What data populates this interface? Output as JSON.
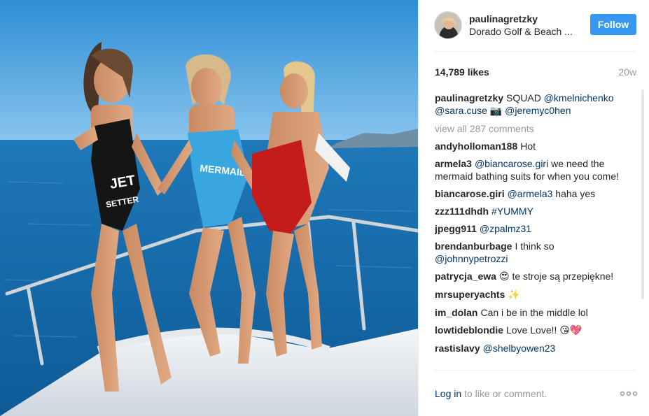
{
  "post": {
    "username": "paulinagretzky",
    "location": "Dorado Golf & Beach ...",
    "follow_label": "Follow",
    "likes": "14,789 likes",
    "age": "20w"
  },
  "caption": {
    "user": "paulinagretzky",
    "text": "SQUAD",
    "mention1": "@kmelnichenko",
    "mention2": "@sara.cuse",
    "camera_emoji": "📷",
    "mention3": "@jeremyc0hen"
  },
  "view_all": "view all 287 comments",
  "comments": [
    {
      "user": "andyholloman188",
      "text": "Hot"
    },
    {
      "user": "armela3",
      "mention": "@biancarose.giri",
      "text": "we need the mermaid bathing suits for when you come!"
    },
    {
      "user": "biancarose.giri",
      "mention": "@armela3",
      "text": "haha yes"
    },
    {
      "user": "zzz111dhdh",
      "mention": "#YUMMY",
      "text": ""
    },
    {
      "user": "jpegg911",
      "mention": "@zpalmz31",
      "text": ""
    },
    {
      "user": "brendanburbage",
      "text": "I think so",
      "mention_after": "@johnnypetrozzi"
    },
    {
      "user": "patrycja_ewa",
      "emoji": "😍",
      "text": "te stroje są przepiękne!"
    },
    {
      "user": "mrsuperyachts",
      "emoji": "✨",
      "text": ""
    },
    {
      "user": "im_dolan",
      "text": "Can i be in the middle lol"
    },
    {
      "user": "lowtideblondie",
      "text": "Love Love!!",
      "emoji": "😘💖"
    },
    {
      "user": "rastislavy",
      "mention": "@shelbyowen23",
      "text": ""
    }
  ],
  "footer": {
    "login_label": "Log in",
    "login_suffix": " to like or comment."
  },
  "icons": {
    "more": "more-options-icon",
    "avatar": "avatar"
  },
  "colors": {
    "follow_button": "#3897f0",
    "link": "#003569",
    "muted": "#999999"
  }
}
